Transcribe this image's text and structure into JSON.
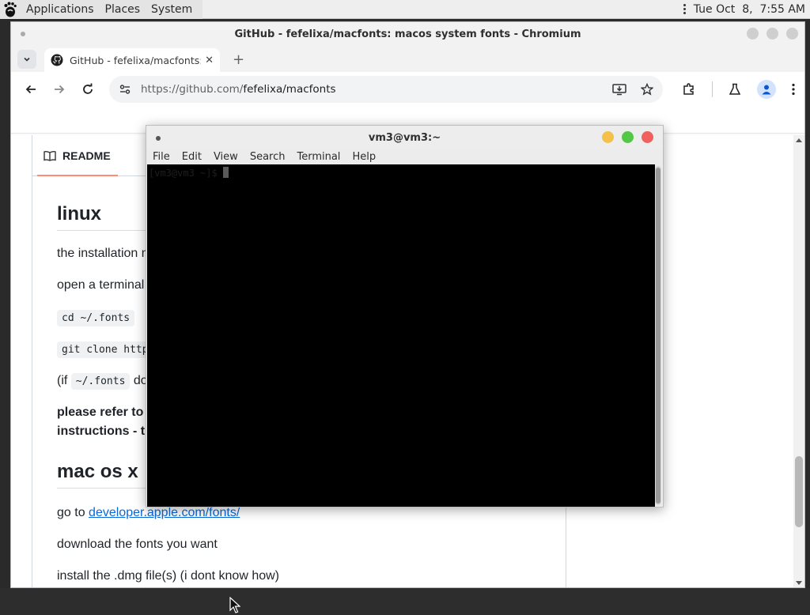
{
  "top_panel": {
    "menus": [
      "Applications",
      "Places",
      "System"
    ],
    "clock": "Tue Oct  8,  7:55 AM"
  },
  "browser": {
    "window_title": "GitHub - fefelixa/macfonts: macos system fonts - Chromium",
    "tab_title": "GitHub - fefelixa/macfonts: macos system fonts",
    "new_tab": "+",
    "url_prefix": "https://github.com/",
    "url_path": "fefelixa/macfonts"
  },
  "readme": {
    "tab_label": "README",
    "h_linux": "linux",
    "p_install": "the installation method is",
    "p_open_terminal": "open a terminal and",
    "code_cd": "cd ~/.fonts",
    "code_git": "git clone https://",
    "p_if_prefix": "(if",
    "code_fonts": "~/.fonts",
    "p_if_suffix": "do",
    "bold_line1": "please refer to",
    "bold_line2": "instructions - th",
    "h_macos": "mac os x",
    "p_goto": "go to",
    "link_dev": "developer.apple.com/fonts/",
    "p_download": "download the fonts you want",
    "p_install_dmg": "install the .dmg file(s) (i dont know how)"
  },
  "terminal": {
    "title": "vm3@vm3:~",
    "menus": [
      "File",
      "Edit",
      "View",
      "Search",
      "Terminal",
      "Help"
    ],
    "prompt": "[vm3@vm3 ~]$ ",
    "colors": {
      "close": "#f0605c",
      "maximize": "#55c746",
      "minimize": "#f5c04a"
    }
  }
}
